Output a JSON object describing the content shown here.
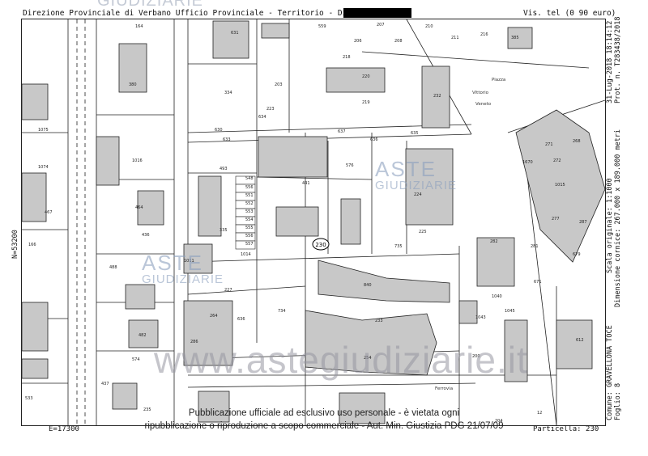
{
  "header": {
    "left": "Direzione Provinciale di Verbano Ufficio Provinciale - Territorio - Direttore",
    "right": "Vis. tel (0 90 euro)"
  },
  "side": {
    "datetime": "31-Lug-2018 18:14:12",
    "prot": "Prot. n. T283438/2018",
    "scale": "Scala originale: 1:1000",
    "frame": "Dimensione cornice: 267.000 x 189.000 metri",
    "comune": "Comune: GRAVELLONA TOCE",
    "foglio": "Foglio: 8"
  },
  "coords": {
    "north": "N=53200",
    "east": "E=17300"
  },
  "particella": "Particella: 230",
  "notice": {
    "line1": "Pubblicazione ufficiale ad esclusivo uso personale - è vietata ogni",
    "line2": "ripubblicazione o riproduzione a scopo commerciale - Aut. Min. Giustizia PDG 21/07/09"
  },
  "watermark": {
    "site": "www.astegiudiziarie.it",
    "logo_top": "ASTE",
    "logo_bottom": "GIUDIZIARIE",
    "top_partial": "GIUDIZIARIE"
  },
  "map": {
    "highlight": "230",
    "streets": [
      "Piazza",
      "Vittorio",
      "Veneto",
      "Ferrovia"
    ],
    "parcels": [
      "164",
      "380",
      "631",
      "559",
      "206",
      "207",
      "208",
      "210",
      "211",
      "216",
      "385",
      "218",
      "220",
      "219",
      "232",
      "334",
      "203",
      "223",
      "634",
      "630",
      "633",
      "637",
      "635",
      "636",
      "1016",
      "1075",
      "1074",
      "493",
      "548",
      "556",
      "551",
      "552",
      "553",
      "554",
      "555",
      "556",
      "557",
      "1014",
      "576",
      "441",
      "224",
      "225",
      "735",
      "335",
      "840",
      "436",
      "464",
      "467",
      "166",
      "488",
      "1011",
      "227",
      "636",
      "264",
      "286",
      "734",
      "233",
      "254",
      "482",
      "574",
      "437",
      "533",
      "235",
      "271",
      "268",
      "1670",
      "272",
      "1015",
      "277",
      "287",
      "281",
      "679",
      "671",
      "282",
      "1045",
      "1040",
      "612",
      "1043",
      "200",
      "204",
      "12"
    ]
  }
}
